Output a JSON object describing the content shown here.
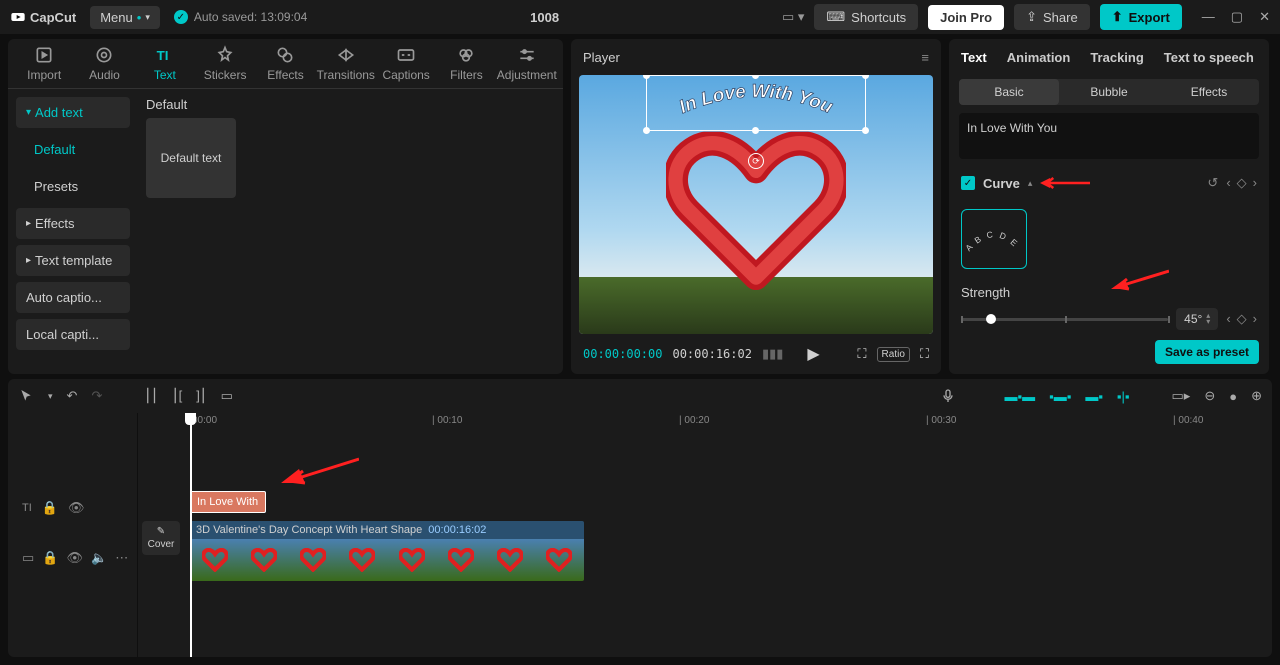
{
  "titlebar": {
    "app": "CapCut",
    "menu": "Menu",
    "autosaved": "Auto saved: 13:09:04",
    "projectName": "1008",
    "shortcuts": "Shortcuts",
    "joinPro": "Join Pro",
    "share": "Share",
    "export": "Export"
  },
  "mediaTabs": [
    "Import",
    "Audio",
    "Text",
    "Stickers",
    "Effects",
    "Transitions",
    "Captions",
    "Filters",
    "Adjustment"
  ],
  "leftSidebar": {
    "addText": "Add text",
    "default": "Default",
    "presets": "Presets",
    "effects": "Effects",
    "textTemplate": "Text template",
    "autoCaptions": "Auto captio...",
    "localCaptions": "Local capti..."
  },
  "leftContent": {
    "heading": "Default",
    "thumbLabel": "Default text"
  },
  "player": {
    "title": "Player",
    "curvedText": "In Love With You",
    "currentTime": "00:00:00:00",
    "duration": "00:00:16:02",
    "ratio": "Ratio"
  },
  "inspector": {
    "tabs": [
      "Text",
      "Animation",
      "Tracking",
      "Text to speech"
    ],
    "subtabs": [
      "Basic",
      "Bubble",
      "Effects"
    ],
    "textValue": "In Love With You",
    "curveLabel": "Curve",
    "curvePreview": "A B C D E",
    "strengthLabel": "Strength",
    "strengthValue": "45°",
    "savePreset": "Save as preset"
  },
  "timeline": {
    "marks": [
      "00:00",
      "| 00:10",
      "| 00:20",
      "| 00:30",
      "| 00:40"
    ],
    "cover": "Cover",
    "textClip": "In Love With",
    "videoClipName": "3D Valentine's Day Concept With Heart Shape",
    "videoClipDur": "00:00:16:02"
  }
}
